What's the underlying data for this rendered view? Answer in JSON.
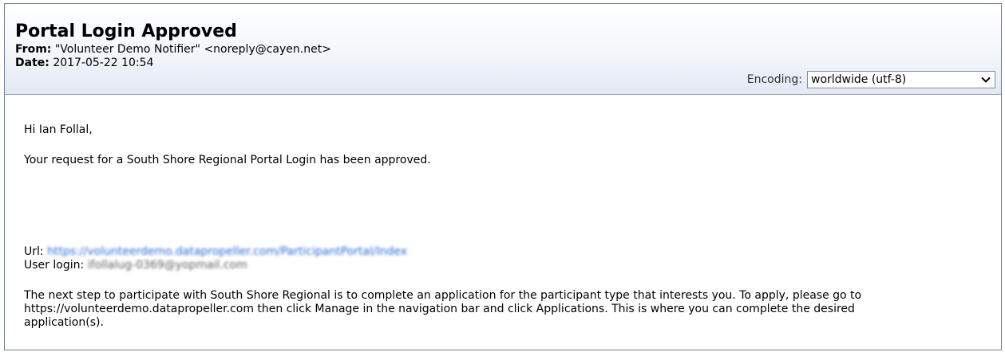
{
  "email": {
    "subject": "Portal Login Approved",
    "from_label": "From:",
    "from_value": "\"Volunteer Demo Notifier\" <noreply@cayen.net>",
    "date_label": "Date:",
    "date_value": "2017-05-22 10:54"
  },
  "encoding": {
    "label": "Encoding:",
    "selected": "worldwide (utf-8)",
    "icon": "chevron-down-icon"
  },
  "message": {
    "greeting": "Hi Ian Follal,",
    "approval": "Your request for a South Shore Regional Portal Login has been approved.",
    "url_label": "Url:",
    "url_value": "https://volunteerdemo.datapropeller.com/ParticipantPortal/Index",
    "login_label": "User login:",
    "login_value": "ifollalug-0369@yopmail.com",
    "next_step": "The next step to participate with South Shore Regional is to complete an application for the participant type that interests you. To apply, please go to https://volunteerdemo.datapropeller.com then click Manage in the navigation bar and click Applications. This is where you can complete the desired application(s)."
  },
  "colors": {
    "link": "#2a6ad8",
    "header_gradient_end": "#e2e9f4",
    "border": "#6f7f93"
  }
}
